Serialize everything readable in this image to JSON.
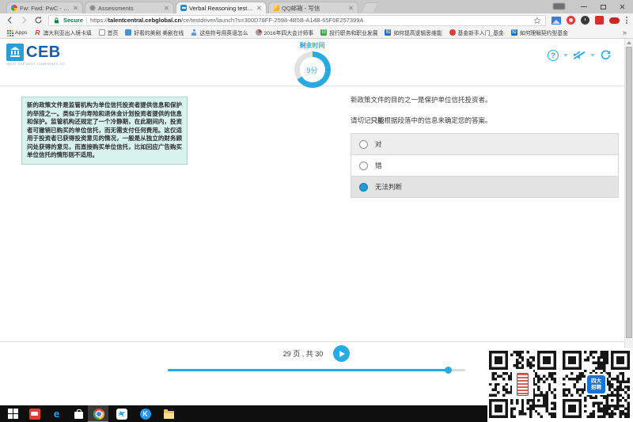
{
  "theme": {
    "accent": "#29abe2",
    "ceb_blue": "#1d5ca8",
    "secure_green": "#0b8043",
    "selected_radio": "#1e9ad7",
    "passage_bg": "#d7f3ec"
  },
  "browser": {
    "tabs": [
      {
        "title": "Fw: Fwd: PwC - thank yo"
      },
      {
        "title": "Assessments"
      },
      {
        "title": "Verbal Reasoning test | T"
      },
      {
        "title": "QQ邮箱 - 写信"
      }
    ],
    "address": {
      "security_label": "Secure",
      "url_scheme": "https://",
      "url_domain": "talentcentral.cebglobal.cn",
      "url_path": "/ce/testdriver/launch?s=300D78FF-2598-4B5B-A14B-65F0E257399A"
    },
    "bookmarks": [
      {
        "label": "Apps",
        "badge": ""
      },
      {
        "label": "澳大利亚出入境卡填",
        "badge": "R"
      },
      {
        "label": "首页",
        "badge": ""
      },
      {
        "label": "好看的美剧 美剧在线",
        "badge": ""
      },
      {
        "label": "这些符号用英语怎么",
        "badge": ""
      },
      {
        "label": "2016年四大会计师事",
        "badge": ""
      },
      {
        "label": "投行职务和职业发展",
        "badge": "日"
      },
      {
        "label": "如何提高逻辑思维能",
        "badge": "知"
      },
      {
        "label": "基金新手入门_基金",
        "badge": ""
      },
      {
        "label": "如何理解契约型基金",
        "badge": "知"
      }
    ],
    "bookmarks_overflow": "»"
  },
  "header": {
    "logo_text": "CEB",
    "logo_tagline": "WHAT THE BEST COMPANIES DO",
    "timer_label": "剩余时间",
    "timer_value": "9分",
    "timer_fraction": 0.66,
    "help_glyph": "?"
  },
  "content": {
    "passage": "新的政策文件是监管机构为单位信托投资者提供信息和保护的举措之一。类似于向寿险和退休金计划投资者提供的信息和保护。监管机构还规定了一个冷静期，在此期间内，投资者可撤销已购买的单位信托，而无需支付任何费用。这仅适用于投资者已获得投资意见的情况，一般是从独立的财务顾问处获得的意见，而直接购买单位信托，比如回应广告购买单位信托的情形则不适用。",
    "statement": "新政策文件的目的之一是保护单位信托投资者。",
    "instruction_prefix": "请切记",
    "instruction_bold": "只能",
    "instruction_suffix": "根据段落中的信息来确定您的答案。",
    "options": [
      {
        "label": "对",
        "selected": false
      },
      {
        "label": "错",
        "selected": false
      },
      {
        "label": "无法判断",
        "selected": true
      }
    ]
  },
  "footer": {
    "page_text": "29 页 , 共 30",
    "progress_fraction": 0.945
  },
  "overlay": {
    "qr2_logo_line1": "四大",
    "qr2_logo_line2": "招聘"
  },
  "taskbar": {
    "edge_glyph": "e",
    "k_glyph": "K"
  }
}
